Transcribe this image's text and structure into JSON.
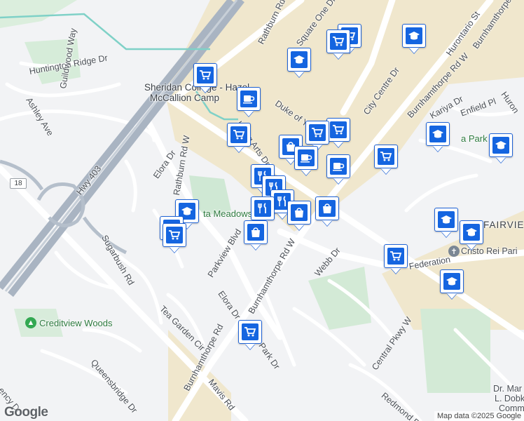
{
  "labels": {
    "huntington_ridge": "Huntington Ridge Dr",
    "guildwood": "Guildwood Way",
    "ashley": "Ashley Ave",
    "hwy403": "Hwy 403",
    "hwy_shield": "18",
    "sheridan": "Sheridan College - Hazel",
    "mccallion": "McCallion Camp",
    "rathburn_top": "Rathburn Rd W",
    "square_one": "Square One Dr",
    "hurontario": "Hurontario St",
    "burnhamthorpe_ne": "Burnhamthorpe Rd W",
    "burnhamthorpe_far": "Burnhamthorpe",
    "huron_edge": "Huron",
    "duke_of_york": "Duke of York",
    "living_arts": "Living Arts Dr",
    "city_centre": "City Centre Dr",
    "kariya": "Kariya Dr",
    "enfield": "Enfield Pl",
    "park_ne": "a Park",
    "elora_top": "Elora Dr",
    "rathburn_left": "Rathburn Rd W",
    "meadows": "ta Meadows",
    "sugarbush": "Sugarbush Rd",
    "parkview": "Parkview Blvd",
    "burnhamthorpe_mid": "Burnhamthorpe Rd W",
    "elora_mid": "Elora Dr",
    "webb": "Webb Dr",
    "federation": "Federation",
    "fairview": "FAIRVIE",
    "cristo": "Cristo Rei Pari",
    "tea_garden": "Tea Garden Cir",
    "creditview": "Creditview Woods",
    "burnhamthorpe_low": "Burnhamthorpe Rd",
    "park_dr": "Park Dr",
    "central_pkwy": "Central Pkwy W",
    "queensbridge": "Queensbridge Dr",
    "mavis": "Mavis Rd",
    "redmond": "Redmond Rd",
    "agency": "ency Dr",
    "dr_mar": "Dr. Mar",
    "dobk": "L. Dobk",
    "commu": "Commu"
  },
  "pins": [
    {
      "type": "shopping-cart",
      "name": "pin-grocery-1"
    },
    {
      "type": "shopping-cart",
      "name": "pin-grocery-2"
    },
    {
      "type": "shopping-cart",
      "name": "pin-grocery-3"
    },
    {
      "type": "education",
      "name": "pin-school-1"
    },
    {
      "type": "education",
      "name": "pin-school-2"
    },
    {
      "type": "shopping-cart",
      "name": "pin-grocery-4"
    },
    {
      "type": "coffee",
      "name": "pin-cafe-1"
    },
    {
      "type": "shopping-cart",
      "name": "pin-grocery-5"
    },
    {
      "type": "shopping-cart",
      "name": "pin-grocery-6"
    },
    {
      "type": "shopping-bag",
      "name": "pin-store-1"
    },
    {
      "type": "coffee",
      "name": "pin-cafe-2"
    },
    {
      "type": "coffee",
      "name": "pin-cafe-3"
    },
    {
      "type": "shopping-cart",
      "name": "pin-grocery-7"
    },
    {
      "type": "education",
      "name": "pin-school-3"
    },
    {
      "type": "education",
      "name": "pin-school-4"
    },
    {
      "type": "restaurant",
      "name": "pin-restaurant-1"
    },
    {
      "type": "restaurant",
      "name": "pin-restaurant-2"
    },
    {
      "type": "restaurant",
      "name": "pin-restaurant-3"
    },
    {
      "type": "restaurant",
      "name": "pin-restaurant-4"
    },
    {
      "type": "shopping-bag",
      "name": "pin-store-2"
    },
    {
      "type": "shopping-bag",
      "name": "pin-store-3"
    },
    {
      "type": "shopping-bag",
      "name": "pin-store-4"
    },
    {
      "type": "education",
      "name": "pin-school-5"
    },
    {
      "type": "shopping-cart",
      "name": "pin-grocery-8"
    },
    {
      "type": "shopping-cart",
      "name": "pin-grocery-9"
    },
    {
      "type": "education",
      "name": "pin-school-6"
    },
    {
      "type": "education",
      "name": "pin-school-7"
    },
    {
      "type": "shopping-cart",
      "name": "pin-grocery-10"
    },
    {
      "type": "education",
      "name": "pin-school-8"
    },
    {
      "type": "shopping-cart",
      "name": "pin-grocery-11"
    }
  ],
  "branding": {
    "logo": "Google",
    "attribution": "Map data ©2025 Google"
  },
  "colors": {
    "pin_border": "#1f63d6",
    "pin_icon_bg": "#1565e0",
    "highway": "#a9b4c2",
    "commercial": "#f1e6c8",
    "park": "#c9e8cf"
  }
}
